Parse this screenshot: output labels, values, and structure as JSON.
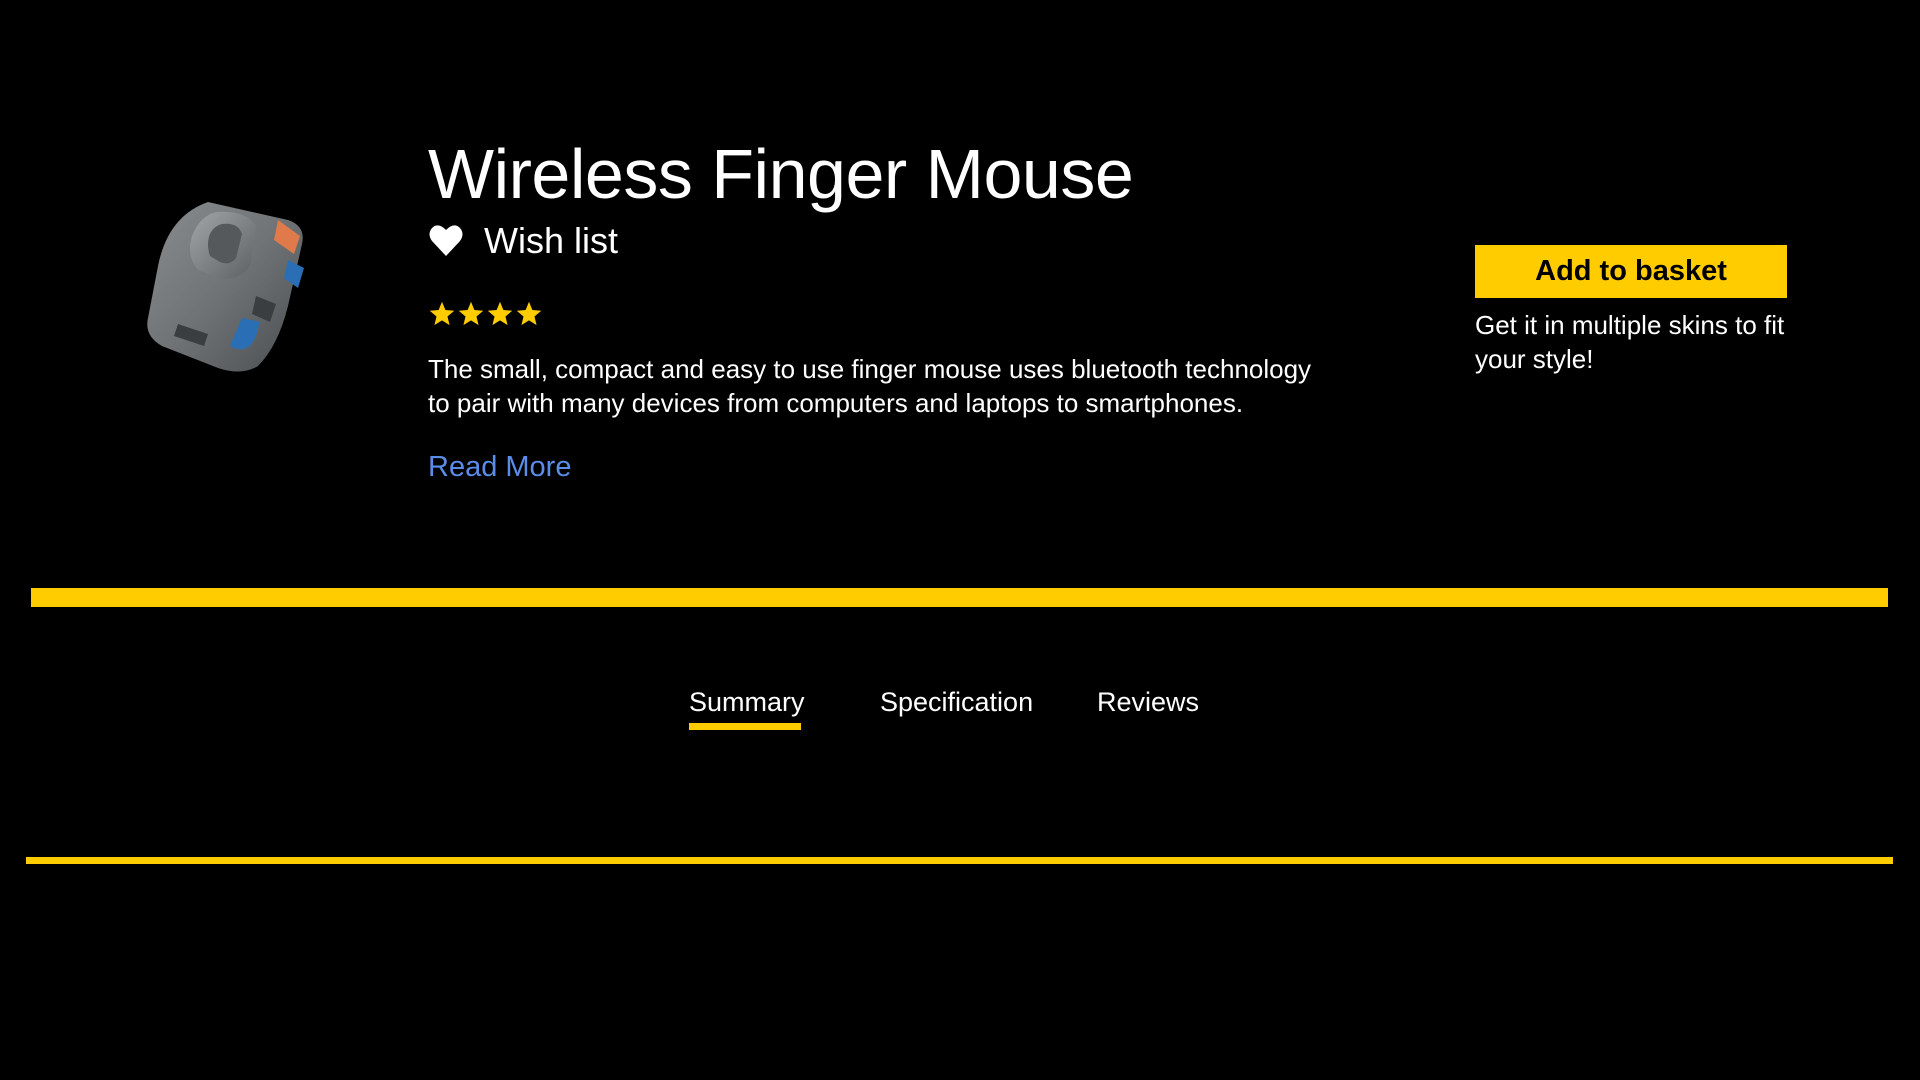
{
  "colors": {
    "background": "#000000",
    "text": "#ffffff",
    "accent": "#ffcc00",
    "link": "#5b8de8"
  },
  "product": {
    "title": "Wireless Finger Mouse",
    "image_icon": "finger-mouse-image",
    "wishlist_label": "Wish list",
    "wishlist_icon": "heart-icon",
    "rating_stars": 4,
    "rating_max": 4,
    "description": "The small, compact and easy to use finger mouse uses bluetooth technology to pair with many devices from computers and laptops to smartphones.",
    "read_more_label": "Read More"
  },
  "purchase": {
    "button_label": "Add to basket",
    "note": "Get it in multiple skins to fit your style!"
  },
  "tabs": {
    "active": "Summary",
    "items": [
      {
        "label": "Summary"
      },
      {
        "label": "Specification"
      },
      {
        "label": "Reviews"
      }
    ]
  }
}
